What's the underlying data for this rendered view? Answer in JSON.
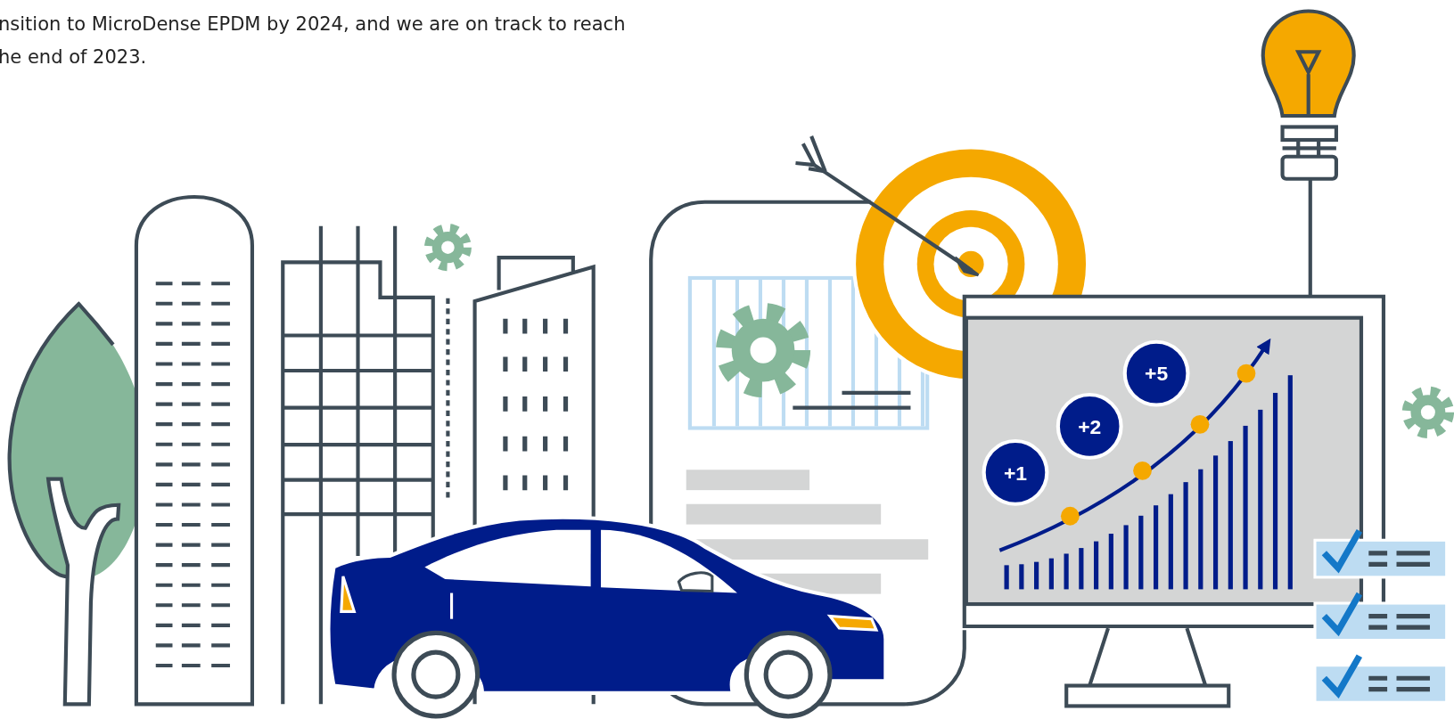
{
  "paragraph": {
    "lines": [
      "nsition to MicroDense EPDM by 2024, and we are on track to reach",
      "he end of 2023."
    ]
  },
  "illustration": {
    "badges": [
      "+1",
      "+2",
      "+5"
    ]
  }
}
